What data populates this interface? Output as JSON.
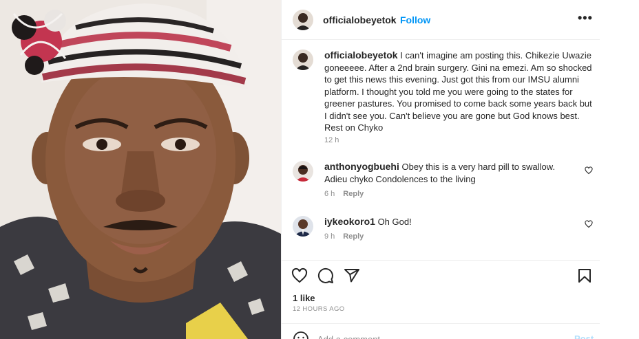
{
  "post": {
    "username": "officialobeyetok",
    "separator": "•",
    "follow_label": "Follow",
    "more_label": "•••"
  },
  "caption": {
    "username": "officialobeyetok",
    "text": "I can't imagine am posting this. Chikezie Uwazie goneeeee. After a 2nd brain surgery. Gini na emezi. Am so shocked to get this news this evening. Just got this from our IMSU alumni platform. I thought you told me you were going to the states for greener pastures. You promised to come back some years back but I didn't see you. Can't believe you are gone but God knows best. Rest on Chyko",
    "time": "12 h"
  },
  "comments": [
    {
      "username": "anthonyogbuehi",
      "text": "Obey this is a very hard pill to swallow. Adieu chyko Condolences to the living",
      "time": "6 h",
      "reply_label": "Reply"
    },
    {
      "username": "iykeokoro1",
      "text": "Oh God!",
      "time": "9 h",
      "reply_label": "Reply"
    }
  ],
  "actions": {
    "icons": [
      "heart-icon",
      "comment-icon",
      "share-icon",
      "bookmark-icon"
    ]
  },
  "likes": "1 like",
  "date": "12 HOURS AGO",
  "add_comment": {
    "placeholder": "Add a comment...",
    "post_label": "Post"
  }
}
